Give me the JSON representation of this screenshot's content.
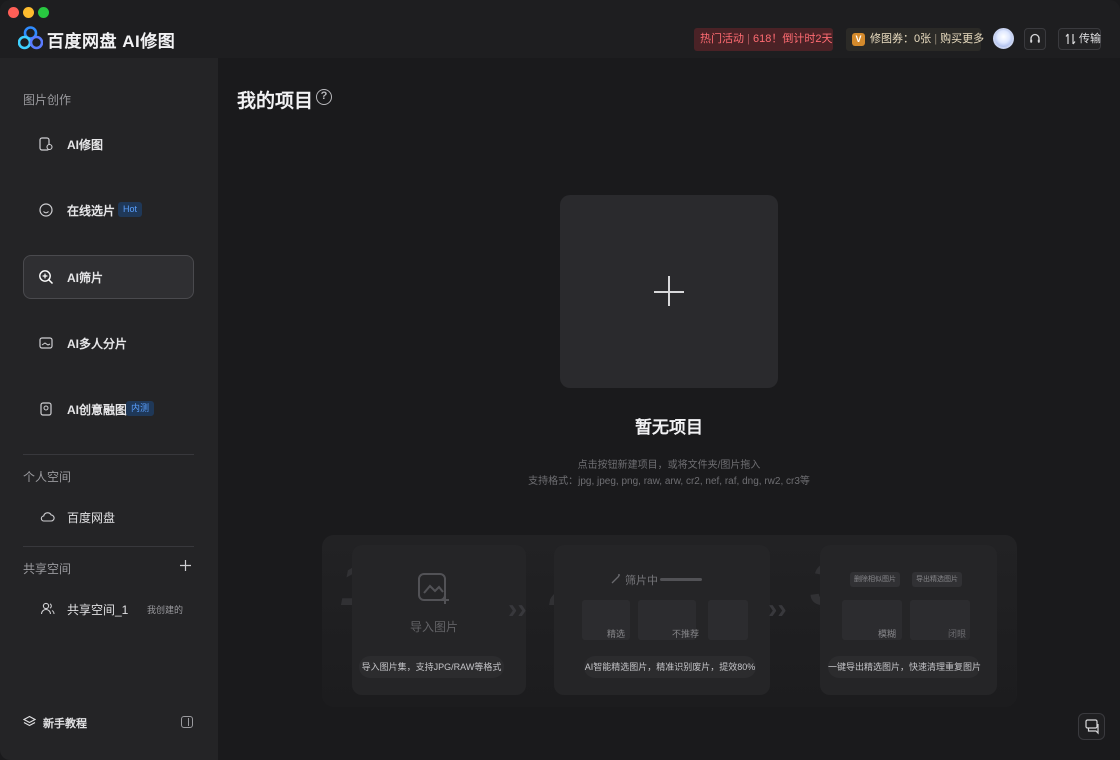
{
  "window": {
    "brand": "百度网盘 AI修图"
  },
  "header": {
    "promo_label": "热门活动",
    "promo_detail": "618！倒计时2天",
    "coupon_badge": "V",
    "coupon_label": "修图券：0张",
    "coupon_buy": "购买更多",
    "transfer_label": "传输"
  },
  "sidebar": {
    "section_create": "图片创作",
    "items": [
      {
        "label": "AI修图",
        "icon": "ai-retouch-icon"
      },
      {
        "label": "在线选片",
        "icon": "face-icon",
        "tag": "Hot"
      },
      {
        "label": "AI筛片",
        "icon": "zoom-search-icon",
        "active": true
      },
      {
        "label": "AI多人分片",
        "icon": "photo-group-icon"
      },
      {
        "label": "AI创意融图",
        "icon": "image-blend-icon",
        "tag": "内测"
      }
    ],
    "section_personal": "个人空间",
    "personal_item": "百度网盘",
    "section_shared": "共享空间",
    "shared_item": "共享空间_1",
    "shared_created": "我创建的",
    "tutorial": "新手教程"
  },
  "main": {
    "title": "我的项目",
    "help_glyph": "?",
    "empty_title": "暂无项目",
    "hint_line1": "点击按钮新建项目，或将文件夹/图片拖入",
    "hint_line2": "支持格式：jpg, jpeg, png, raw, arw, cr2, nef, raf, dng, rw2, cr3等"
  },
  "steps": [
    {
      "num": "1",
      "title": "导入图片",
      "caption": "导入图片集，支持JPG/RAW等格式"
    },
    {
      "num": "2",
      "title": "筛片中",
      "caption": "AI智能精选图片，精准识别废片，提效80%",
      "tags": [
        "精选",
        "不推荐"
      ]
    },
    {
      "num": "3",
      "caption": "一键导出精选图片，快速清理重复图片",
      "tags": [
        "删除相似图片",
        "导出精选图片",
        "模糊",
        "闭眼"
      ]
    }
  ],
  "colors": {
    "accent_blue": "#5aa0ff",
    "promo_red": "#ff6b72",
    "background": "#1a1a1c",
    "sidebar": "#242426"
  }
}
